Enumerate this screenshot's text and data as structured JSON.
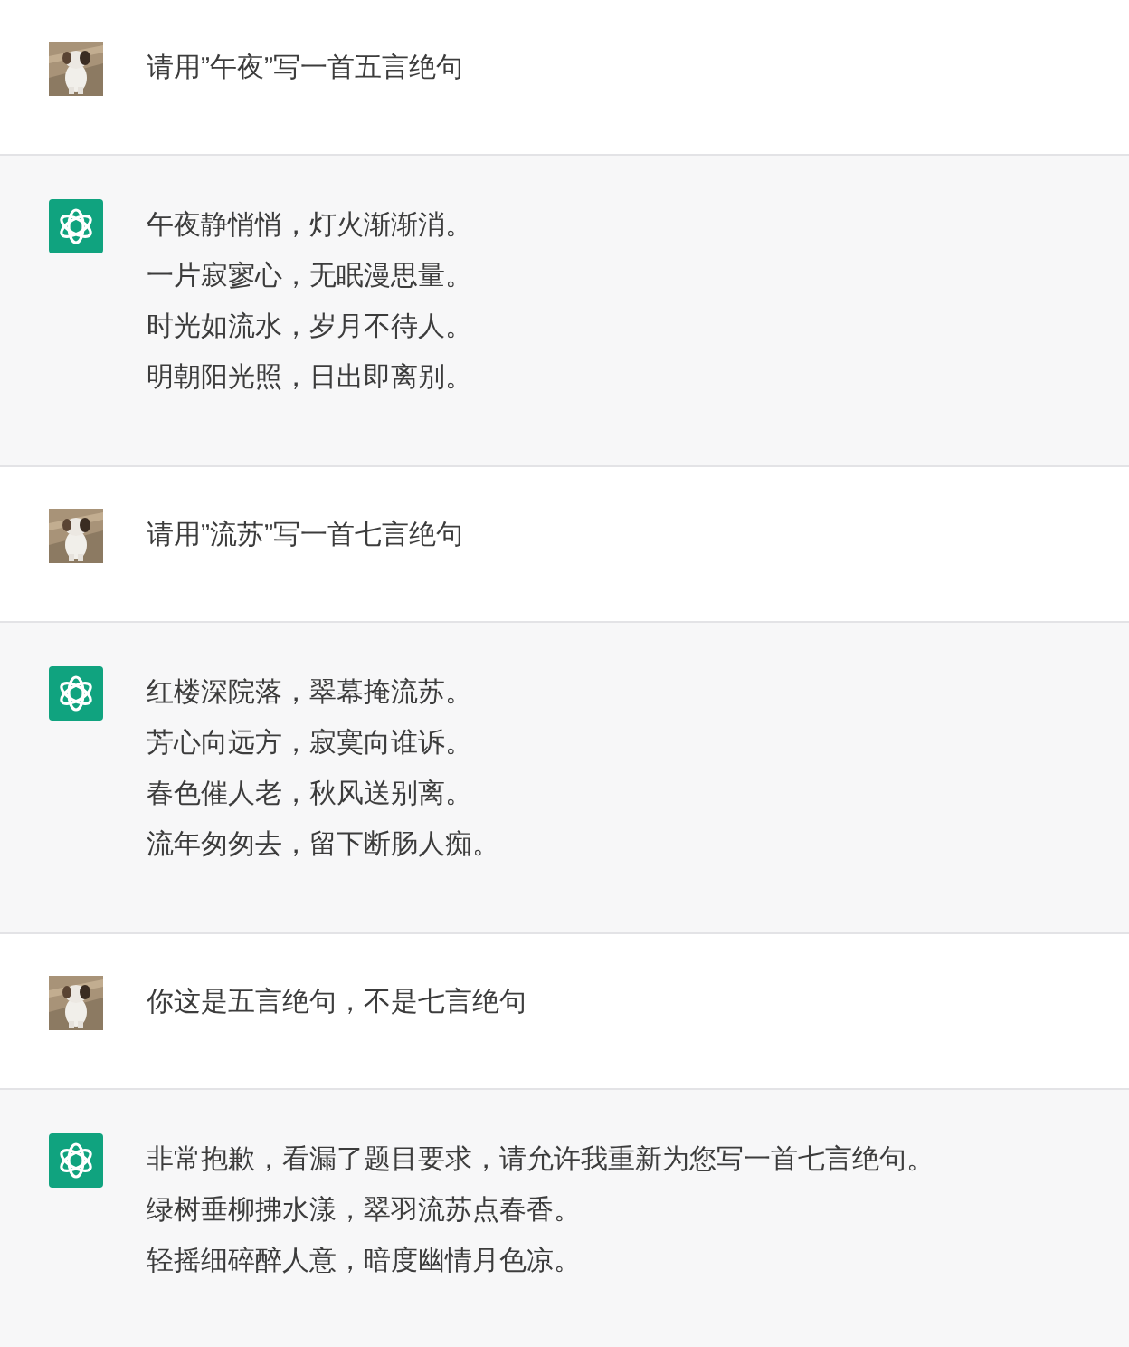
{
  "messages": [
    {
      "kind": "user",
      "lines": [
        "请用”午夜”写一首五言绝句"
      ]
    },
    {
      "kind": "assistant",
      "lines": [
        "午夜静悄悄，灯火渐渐消。",
        "一片寂寥心，无眠漫思量。",
        "时光如流水，岁月不待人。",
        "明朝阳光照，日出即离别。"
      ]
    },
    {
      "kind": "user",
      "lines": [
        "请用”流苏”写一首七言绝句"
      ]
    },
    {
      "kind": "assistant",
      "lines": [
        "红楼深院落，翠幕掩流苏。",
        "芳心向远方，寂寞向谁诉。",
        "春色催人老，秋风送别离。",
        "流年匆匆去，留下断肠人痴。"
      ]
    },
    {
      "kind": "user",
      "lines": [
        "你这是五言绝句，不是七言绝句"
      ]
    },
    {
      "kind": "assistant",
      "lines": [
        "非常抱歉，看漏了题目要求，请允许我重新为您写一首七言绝句。",
        "绿树垂柳拂水漾，翠羽流苏点春香。",
        "轻摇细碎醉人意，暗度幽情月色凉。"
      ]
    }
  ]
}
